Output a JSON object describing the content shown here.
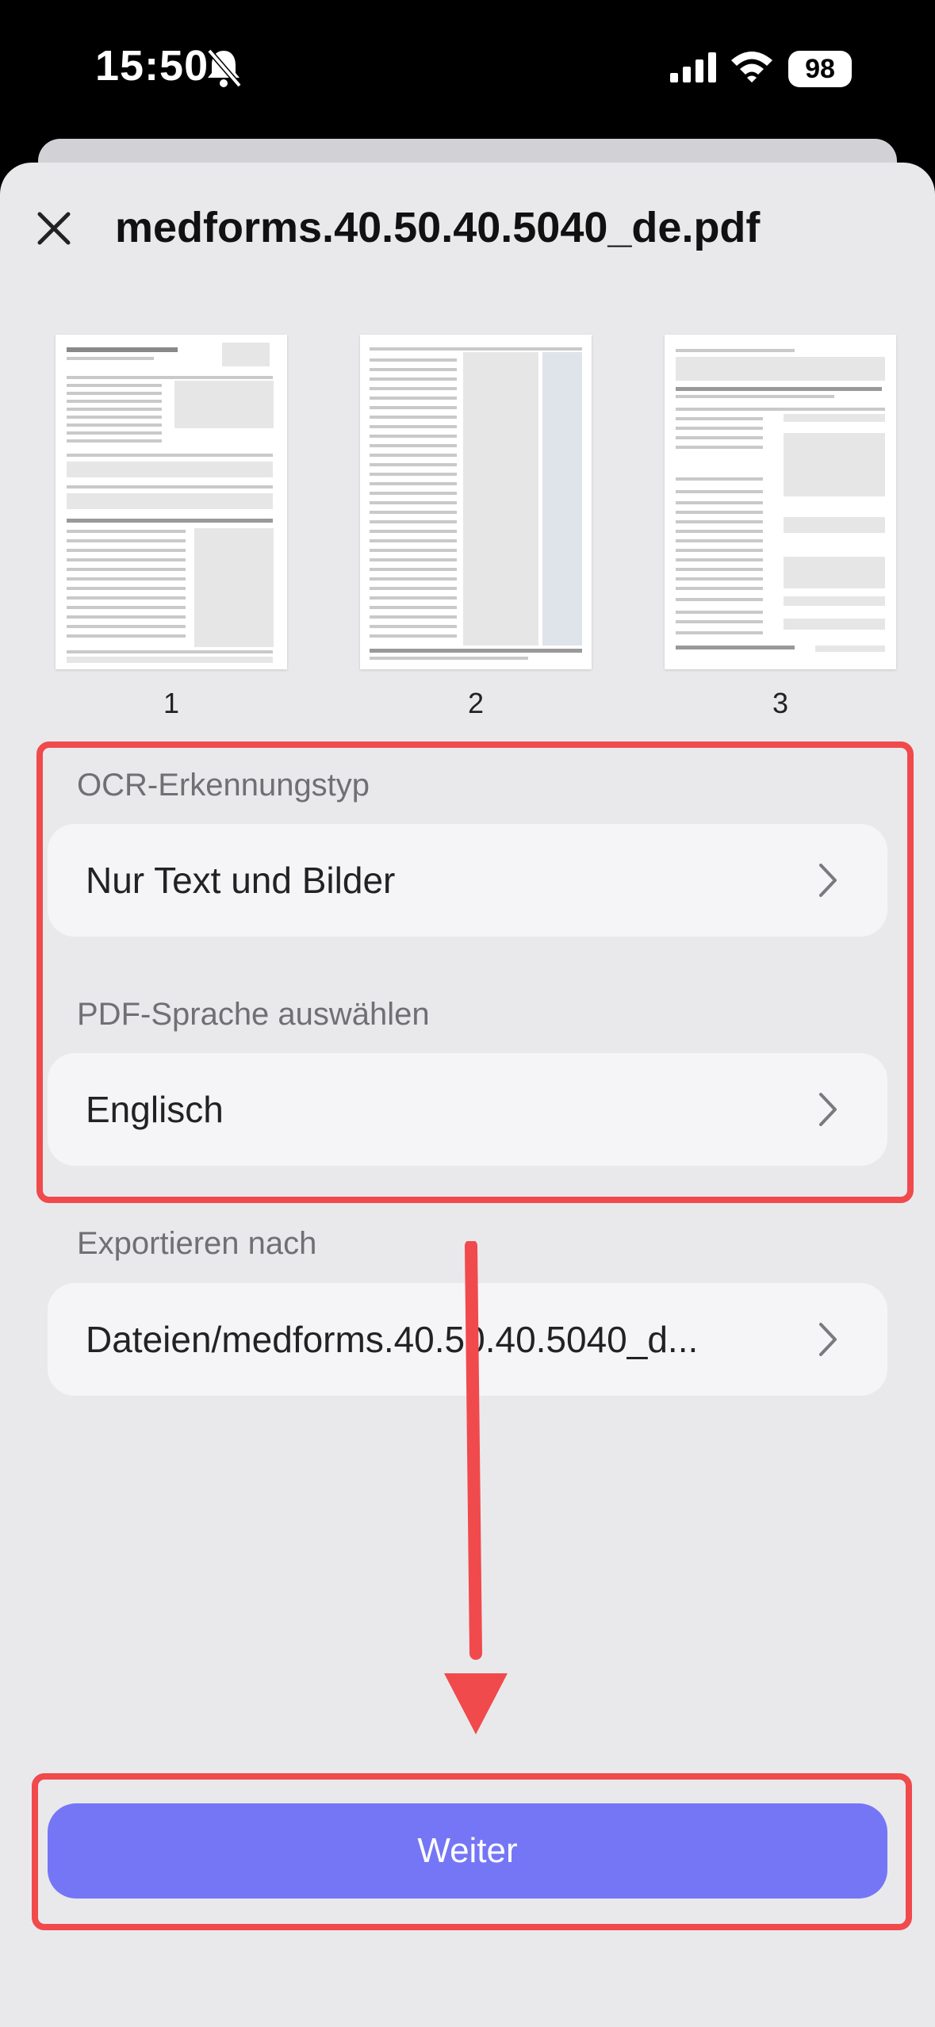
{
  "status_bar": {
    "time": "15:50",
    "battery": "98"
  },
  "header": {
    "title": "medforms.40.50.40.5040_de.pdf"
  },
  "pages": [
    {
      "number": "1"
    },
    {
      "number": "2"
    },
    {
      "number": "3"
    }
  ],
  "ocr": {
    "label": "OCR-Erkennungstyp",
    "value": "Nur Text und Bilder"
  },
  "language": {
    "label": "PDF-Sprache auswählen",
    "value": "Englisch"
  },
  "export": {
    "label": "Exportieren nach",
    "value": "Dateien/medforms.40.50.40.5040_d..."
  },
  "primary_button": {
    "label": "Weiter"
  },
  "colors": {
    "accent": "#7576f6",
    "highlight": "#f04a4c",
    "sheet": "#e9e9ec"
  }
}
